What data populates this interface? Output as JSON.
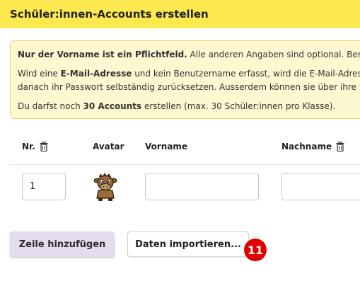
{
  "header": {
    "title": "Schüler:innen-Accounts erstellen"
  },
  "info": {
    "line1_bold": "Nur der Vorname ist ein Pflichtfeld.",
    "line1_rest": " Alle anderen Angaben sind optional. Benutz",
    "line2_pre": "Wird eine ",
    "line2_bold": "E-Mail-Adresse",
    "line2_rest": " und kein Benutzername erfasst, wird die E-Mail-Adres",
    "line3": "danach ihr Passwort selbständig zurücksetzen. Ausserdem können sie über ihre",
    "line4_pre": "Du darfst noch ",
    "line4_bold": "30 Accounts",
    "line4_rest": " erstellen (max. 30 Schüler:innen pro Klasse)."
  },
  "table": {
    "headers": {
      "nr": "Nr.",
      "avatar": "Avatar",
      "vorname": "Vorname",
      "nachname": "Nachname"
    },
    "rows": [
      {
        "nr": "1",
        "vorname": "",
        "nachname": ""
      }
    ]
  },
  "buttons": {
    "add_row": "Zeile hinzufügen",
    "import": "Daten importieren..."
  },
  "badge": "11",
  "colors": {
    "header_bg": "#fce94f",
    "info_bg": "#fef8d0",
    "add_button_bg": "#e6dcef",
    "badge": "#e00000"
  }
}
